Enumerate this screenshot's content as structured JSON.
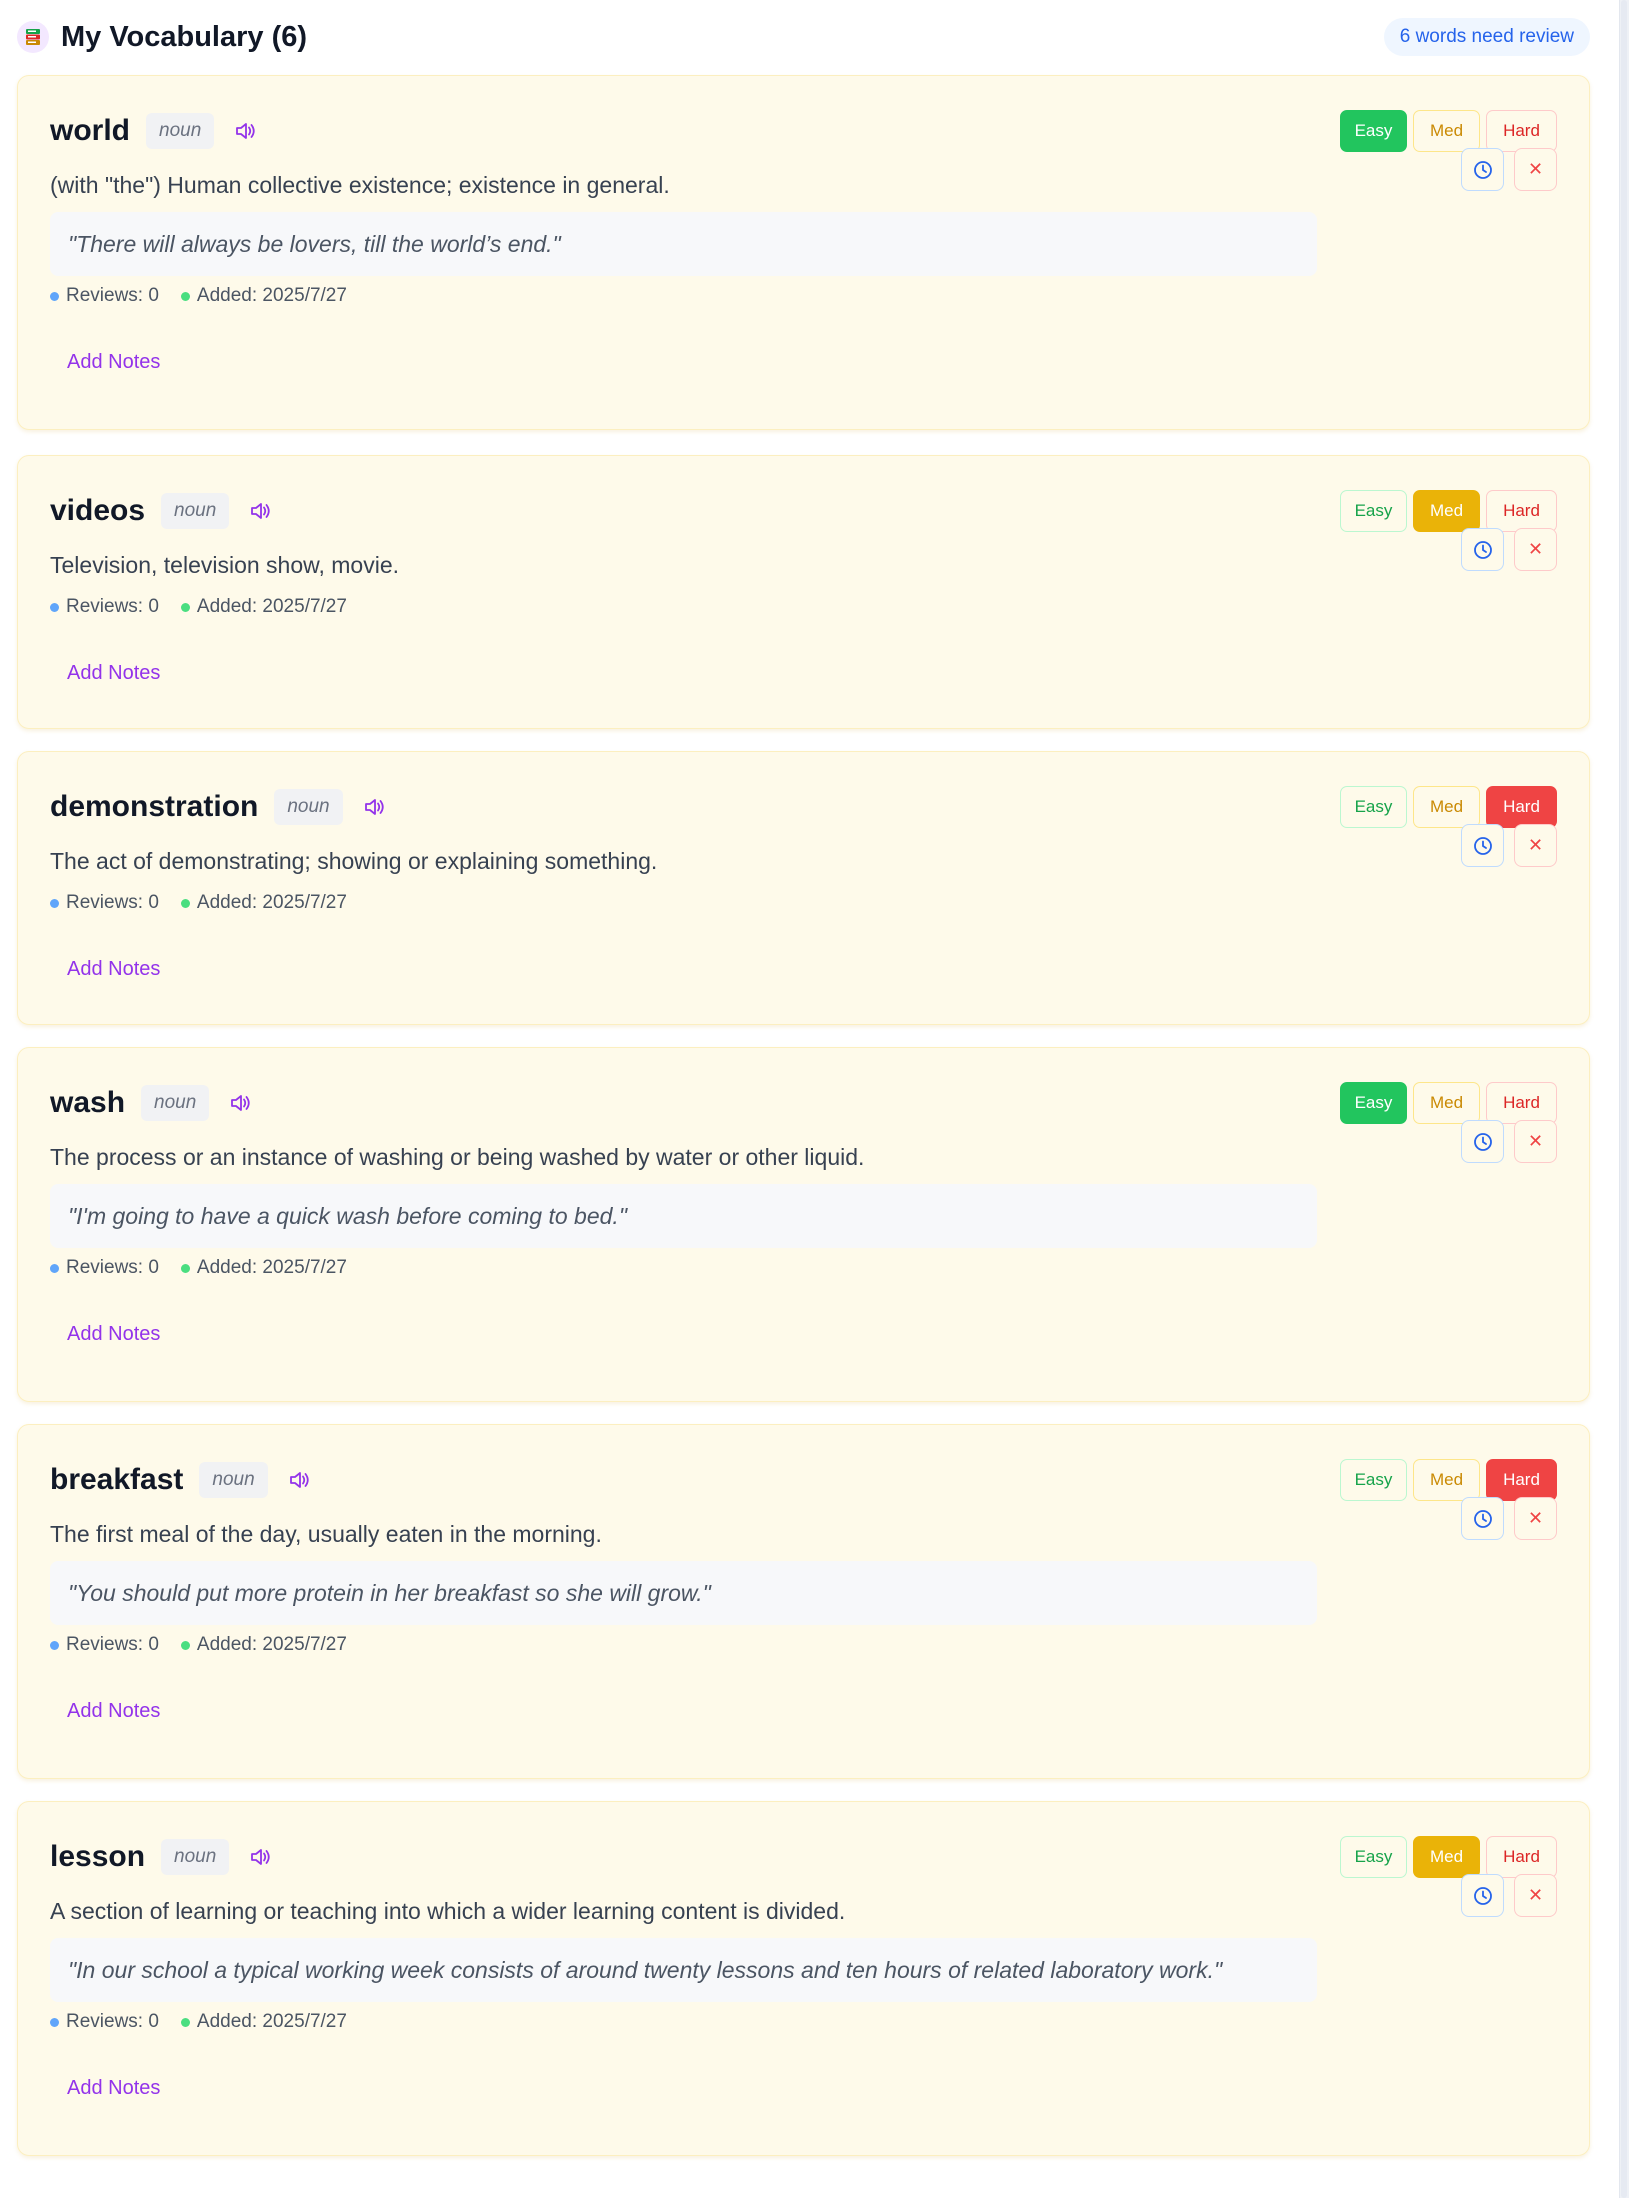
{
  "header": {
    "title": "My Vocabulary (6)",
    "review_badge": "6 words need review",
    "icon": "book-icon"
  },
  "labels": {
    "easy": "Easy",
    "med": "Med",
    "hard": "Hard",
    "add_notes": "Add Notes"
  },
  "colors": {
    "easy_active": "#22c55e",
    "med_active": "#eab308",
    "hard_active": "#ef4444",
    "accent_purple": "#9333ea",
    "card_bg": "#fefaea"
  },
  "words": [
    {
      "word": "world",
      "pos": "noun",
      "definition": "(with \"the\") Human collective existence; existence in general.",
      "example": "\"There will always be lovers, till the world’s end.\"",
      "reviews": "Reviews: 0",
      "added": "Added: 2025/7/27",
      "difficulty": "Easy"
    },
    {
      "word": "videos",
      "pos": "noun",
      "definition": "Television, television show, movie.",
      "example": "",
      "reviews": "Reviews: 0",
      "added": "Added: 2025/7/27",
      "difficulty": "Med"
    },
    {
      "word": "demonstration",
      "pos": "noun",
      "definition": "The act of demonstrating; showing or explaining something.",
      "example": "",
      "reviews": "Reviews: 0",
      "added": "Added: 2025/7/27",
      "difficulty": "Hard"
    },
    {
      "word": "wash",
      "pos": "noun",
      "definition": "The process or an instance of washing or being washed by water or other liquid.",
      "example": "\"I'm going to have a quick wash before coming to bed.\"",
      "reviews": "Reviews: 0",
      "added": "Added: 2025/7/27",
      "difficulty": "Easy"
    },
    {
      "word": "breakfast",
      "pos": "noun",
      "definition": "The first meal of the day, usually eaten in the morning.",
      "example": "\"You should put more protein in her breakfast so she will grow.\"",
      "reviews": "Reviews: 0",
      "added": "Added: 2025/7/27",
      "difficulty": "Hard"
    },
    {
      "word": "lesson",
      "pos": "noun",
      "definition": "A section of learning or teaching into which a wider learning content is divided.",
      "example": "\"In our school a typical working week consists of around twenty lessons and ten hours of related laboratory work.\"",
      "reviews": "Reviews: 0",
      "added": "Added: 2025/7/27",
      "difficulty": "Med"
    }
  ]
}
